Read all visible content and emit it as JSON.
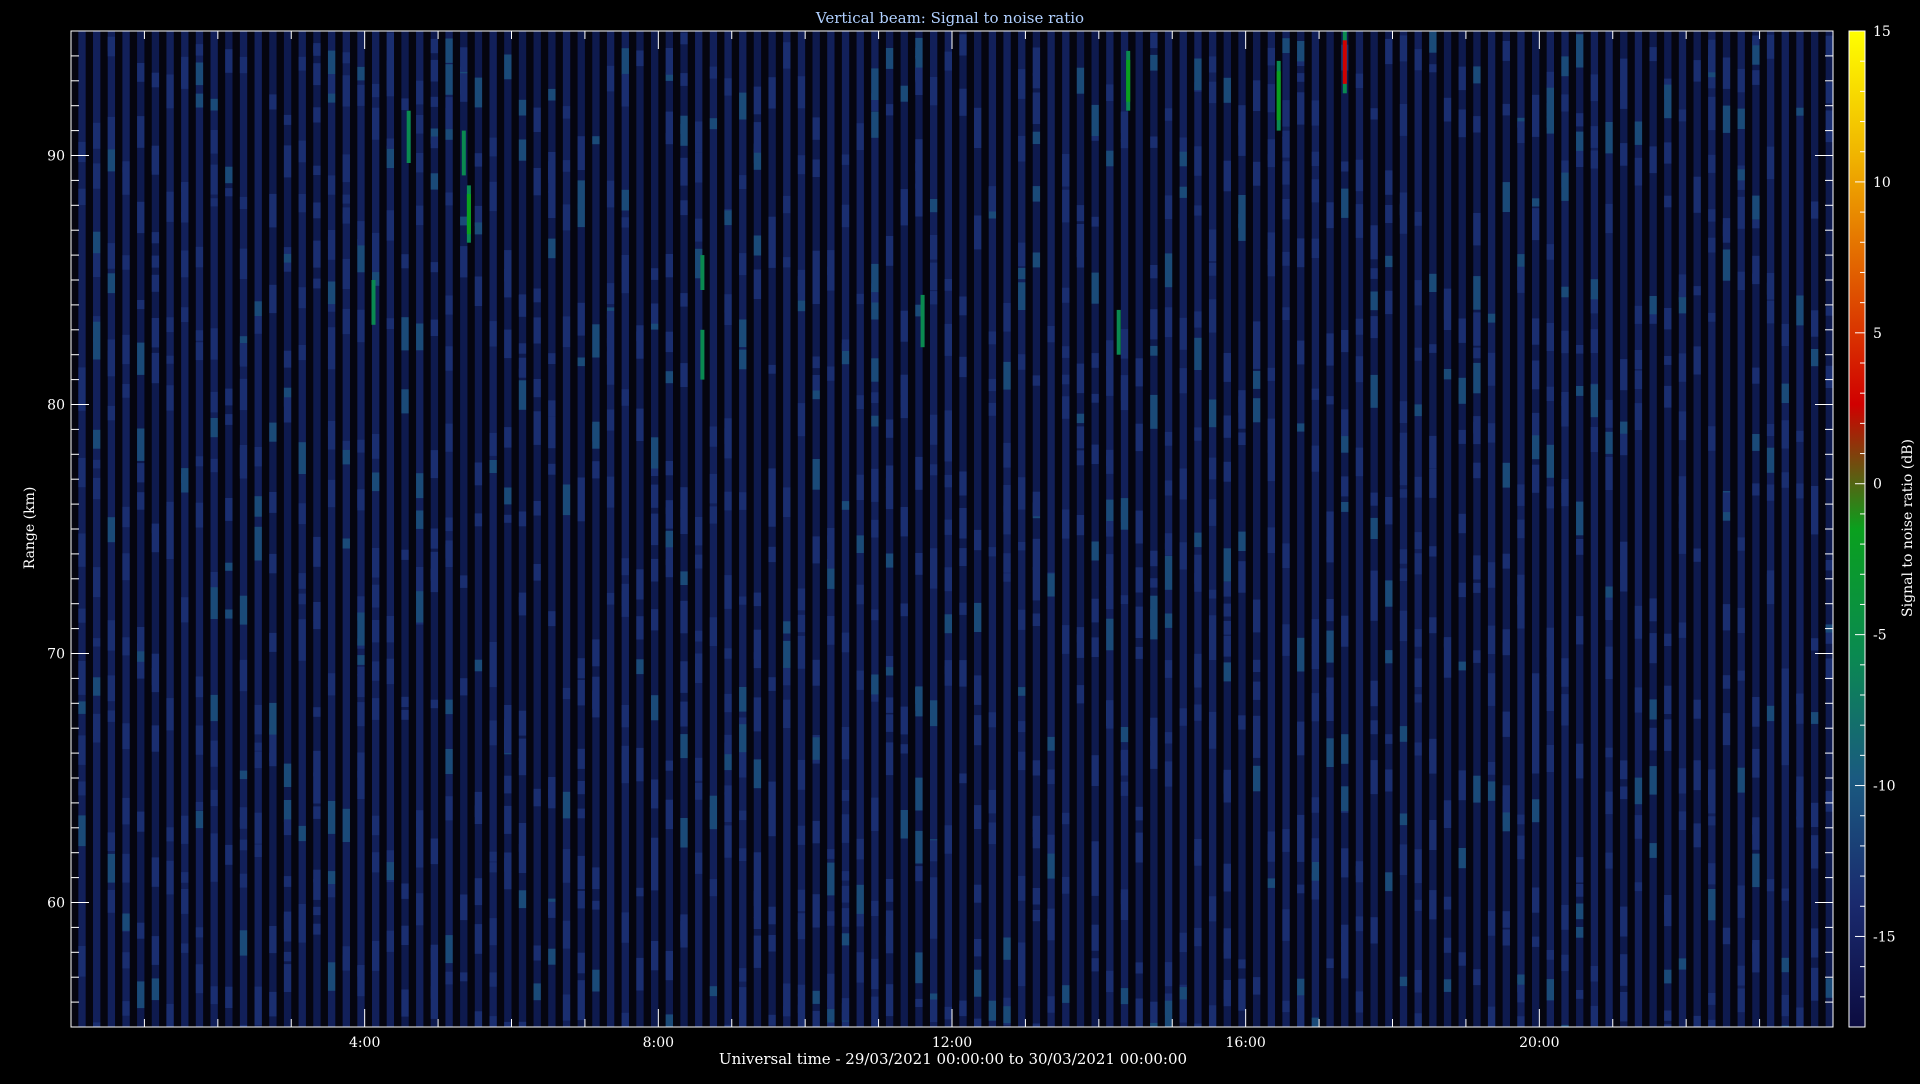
{
  "chart_data": {
    "type": "heatmap",
    "title": "Vertical beam: Signal to noise ratio",
    "xlabel": "Universal time - 29/03/2021 00:00:00 to 30/03/2021 00:00:00",
    "ylabel": "Range (km)",
    "colorbar_label": "Signal to noise ratio (dB)",
    "xlim_hours": [
      0,
      24
    ],
    "ylim_km": [
      55,
      95
    ],
    "clim_db": [
      -18,
      15
    ],
    "x_tick_labels": [
      {
        "hour": 4,
        "label": "4:00"
      },
      {
        "hour": 8,
        "label": "8:00"
      },
      {
        "hour": 12,
        "label": "12:00"
      },
      {
        "hour": 16,
        "label": "16:00"
      },
      {
        "hour": 20,
        "label": "20:00"
      }
    ],
    "y_tick_labels": [
      {
        "km": 60,
        "label": "60"
      },
      {
        "km": 70,
        "label": "70"
      },
      {
        "km": 80,
        "label": "80"
      },
      {
        "km": 90,
        "label": "90"
      }
    ],
    "colorbar_tick_labels": [
      {
        "db": 15,
        "label": "15"
      },
      {
        "db": 10,
        "label": "10"
      },
      {
        "db": 5,
        "label": "5"
      },
      {
        "db": 0,
        "label": "0"
      },
      {
        "db": -5,
        "label": "-5"
      },
      {
        "db": -10,
        "label": "-10"
      },
      {
        "db": -15,
        "label": "-15"
      }
    ],
    "background_noise_db": -15,
    "colormap": [
      "#0c0c40",
      "#1a2a6e",
      "#1a5a80",
      "#0a8a50",
      "#0aa01e",
      "#d00000",
      "#e05a00",
      "#f0b400",
      "#ffff00"
    ],
    "echoes": [
      {
        "time_h": 4.12,
        "range_start_km": 83.2,
        "range_end_km": 85.0,
        "snr_db": -6
      },
      {
        "time_h": 4.6,
        "range_start_km": 89.7,
        "range_end_km": 91.8,
        "snr_db": -6
      },
      {
        "time_h": 5.35,
        "range_start_km": 89.2,
        "range_end_km": 91.0,
        "snr_db": -6
      },
      {
        "time_h": 5.42,
        "range_start_km": 86.5,
        "range_end_km": 88.8,
        "snr_db": 0
      },
      {
        "time_h": 8.6,
        "range_start_km": 84.6,
        "range_end_km": 86.0,
        "snr_db": -5
      },
      {
        "time_h": 8.6,
        "range_start_km": 81.0,
        "range_end_km": 83.0,
        "snr_db": -6
      },
      {
        "time_h": 11.6,
        "range_start_km": 82.3,
        "range_end_km": 84.4,
        "snr_db": -6
      },
      {
        "time_h": 14.27,
        "range_start_km": 82.0,
        "range_end_km": 83.8,
        "snr_db": -6
      },
      {
        "time_h": 14.4,
        "range_start_km": 91.8,
        "range_end_km": 94.2,
        "snr_db": 0
      },
      {
        "time_h": 16.45,
        "range_start_km": 91.0,
        "range_end_km": 93.8,
        "snr_db": 0
      },
      {
        "time_h": 17.35,
        "range_start_km": 92.5,
        "range_end_km": 95.0,
        "snr_db": 1
      }
    ],
    "grid": false,
    "colorbar_position": "right"
  }
}
